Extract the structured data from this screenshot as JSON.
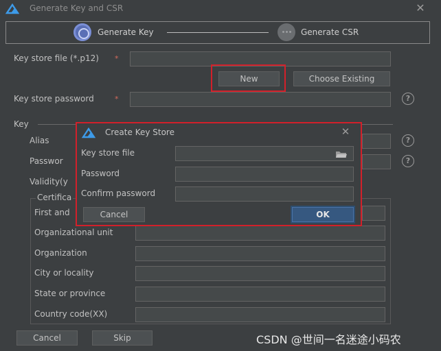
{
  "window": {
    "title": "Generate Key and CSR",
    "close_label": "✕"
  },
  "steps": [
    {
      "label": "Generate Key"
    },
    {
      "label": "Generate CSR"
    }
  ],
  "form": {
    "key_store_file_label": "Key store file (*.p12)",
    "required_mark": "*",
    "new_button": "New",
    "choose_existing_button": "Choose Existing",
    "key_store_password_label": "Key store password",
    "key_section_label": "Key",
    "alias_label": "Alias",
    "password_label": "Passwor",
    "validity_label": "Validity(y",
    "certificate_label": "Certifica",
    "first_and_last_name_label": "First and",
    "organizational_unit_label": "Organizational unit",
    "organization_label": "Organization",
    "city_label": "City or locality",
    "state_label": "State or province",
    "country_label": "Country code(XX)",
    "help_glyph": "?"
  },
  "footer": {
    "cancel_button": "Cancel",
    "skip_button": "Skip"
  },
  "modal": {
    "title": "Create Key Store",
    "close_label": "✕",
    "key_store_file_label": "Key store file",
    "password_label": "Password",
    "confirm_password_label": "Confirm password",
    "cancel_button": "Cancel",
    "ok_button": "OK"
  },
  "watermark": "CSDN @世间一名迷途小码农",
  "colors": {
    "highlight": "#d3202a",
    "primary_button": "#365880",
    "background": "#3c3f41"
  }
}
